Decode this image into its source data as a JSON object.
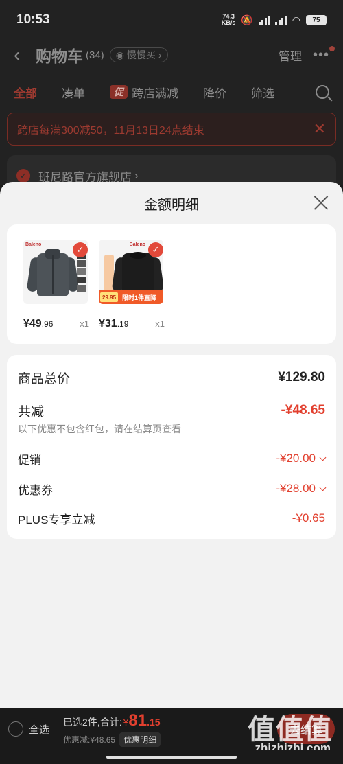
{
  "status": {
    "time": "10:53",
    "net_speed_top": "74.3",
    "net_speed_unit": "KB/s",
    "battery": "75"
  },
  "nav": {
    "back": "‹",
    "title": "购物车",
    "count": "(34)",
    "slow_buy": "慢慢买",
    "manage": "管理",
    "more": "•••"
  },
  "tabs": {
    "all": "全部",
    "combine": "凑单",
    "promo_badge": "促",
    "cross_store": "跨店满减",
    "price_drop": "降价",
    "filter": "筛选"
  },
  "promo_banner": {
    "text": "跨店每满300减50，11月13日24点结束",
    "close": "✕"
  },
  "store": {
    "name": "班尼路官方旗舰店",
    "arrow": "›"
  },
  "sheet": {
    "title": "金额明细",
    "products": [
      {
        "price_main": "¥49",
        "price_cents": ".96",
        "qty": "x1"
      },
      {
        "price_main": "¥31",
        "price_cents": ".19",
        "qty": "x1",
        "tag_price": "29.95",
        "tag_text": "限时1件直降"
      }
    ],
    "brand_mark": "Baleno",
    "total_label": "商品总价",
    "total_value": "¥129.80",
    "discount_label": "共减",
    "discount_value": "-¥48.65",
    "discount_note": "以下优惠不包含红包，请在结算页查看",
    "lines": [
      {
        "label": "促销",
        "value": "-¥20.00"
      },
      {
        "label": "优惠券",
        "value": "-¥28.00"
      },
      {
        "label": "PLUS专享立减",
        "value": "-¥0.65"
      }
    ]
  },
  "bottom": {
    "select_all": "全选",
    "selected": "已选2件,合计:",
    "currency": "¥",
    "total_int": "81",
    "total_dec": ".15",
    "saved": "优惠减:¥48.65",
    "detail_btn": "优惠明细",
    "checkout": "去结算"
  },
  "watermark": {
    "logo": "值值值",
    "site": "zhizhizhi.com"
  },
  "colors": {
    "accent": "#e2402f",
    "sheet_bg": "#f2f2f2",
    "bar_bg": "#1a1a1a"
  }
}
